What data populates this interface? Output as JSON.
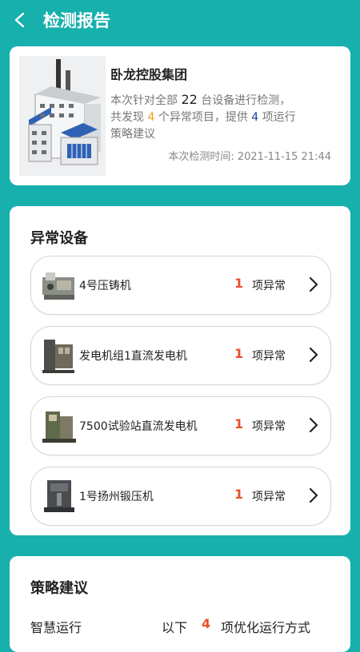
{
  "header": {
    "title": "检测报告",
    "back_icon": "chevron-left-icon"
  },
  "summary": {
    "company": "卧龙控股集团",
    "line1_prefix": "本次针对全部",
    "device_total": "22",
    "line1_suffix": "台设备进行检测，",
    "line2_prefix": "共发现",
    "anomaly_items": "4",
    "line2_mid": "个异常项目，提供",
    "strategy_count": "4",
    "line2_suffix": "项运行",
    "line3": "策略建议",
    "check_time": "本次检测时间: 2021-11-15 21:44",
    "colors": {
      "orange": "#f0a020",
      "blue": "#1f3fa0"
    }
  },
  "anomaly": {
    "title": "异常设备",
    "unit": "项异常",
    "devices": [
      {
        "name": "4号压铸机",
        "count": "1"
      },
      {
        "name": "发电机组1直流发电机",
        "count": "1"
      },
      {
        "name": "7500试验站直流发电机",
        "count": "1"
      },
      {
        "name": "1号扬州锻压机",
        "count": "1"
      }
    ],
    "count_color": "#e8502d"
  },
  "strategy": {
    "title": "策略建议",
    "label": "智慧运行",
    "prefix": "以下",
    "count": "4",
    "suffix": "项优化运行方式"
  },
  "theme": {
    "background": "#18b0ad"
  }
}
